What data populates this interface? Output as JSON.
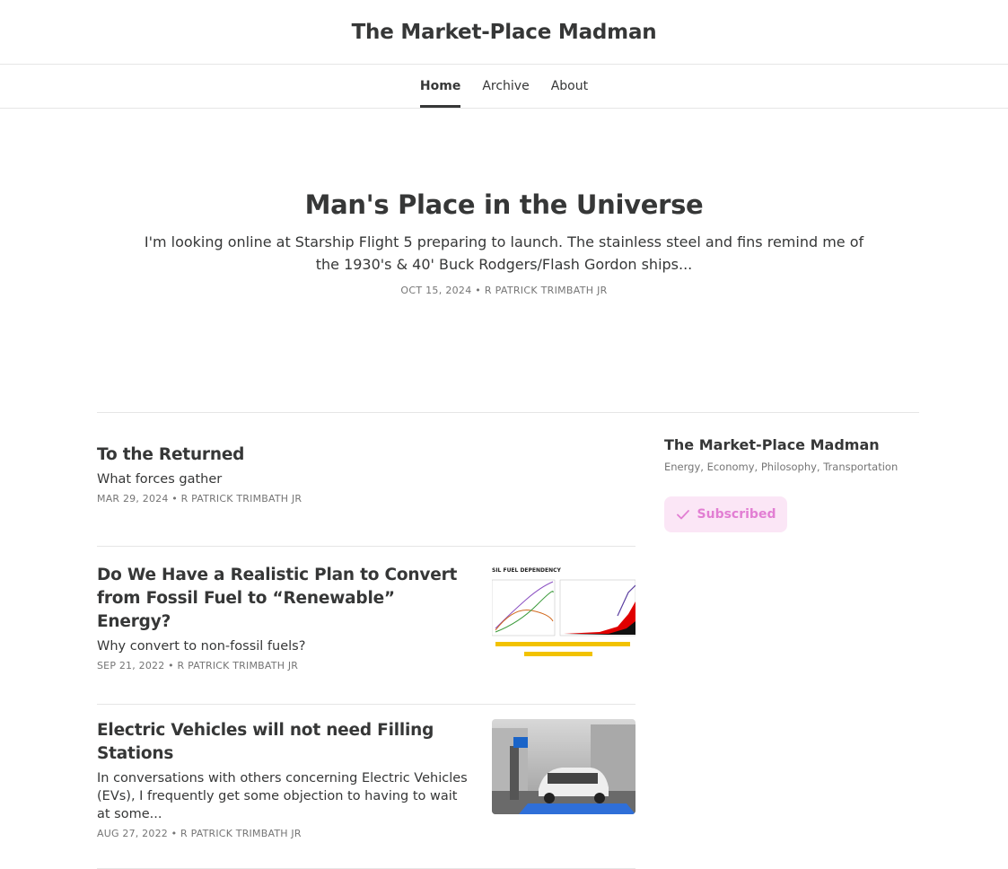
{
  "site": {
    "title": "The Market-Place Madman"
  },
  "nav": {
    "tabs": [
      {
        "label": "Home",
        "active": true
      },
      {
        "label": "Archive"
      },
      {
        "label": "About"
      }
    ]
  },
  "featured": {
    "title": "Man's Place in the Universe",
    "subtitle": "I'm looking online at Starship Flight 5 preparing to launch. The stainless steel and fins remind me of the 1930's & 40' Buck Rodgers/Flash Gordon ships...",
    "meta": "OCT 15, 2024 • R PATRICK TRIMBATH JR"
  },
  "posts": [
    {
      "title": "To the Returned",
      "subtitle": "What forces gather",
      "meta": "MAR 29, 2024 • R PATRICK TRIMBATH JR"
    },
    {
      "title": "Do We Have a Realistic Plan to Convert from Fossil Fuel to “Renewable” Energy?",
      "subtitle": "Why convert to non-fossil fuels?",
      "meta": "SEP 21, 2022 • R PATRICK TRIMBATH JR",
      "thumbnail": {
        "heading": "SIL FUEL DEPENDENCY"
      }
    },
    {
      "title": "Electric Vehicles will not need Filling Stations",
      "subtitle": "In conversations with others concerning Electric Vehicles (EVs), I frequently get some objection to having to wait at some...",
      "meta": "AUG 27, 2022 • R PATRICK TRIMBATH JR",
      "thumbnail": {
        "description": "electric car at charging station"
      }
    }
  ],
  "sidebar": {
    "title": "The Market-Place Madman",
    "tags": "Energy, Economy, Philosophy, Transportation",
    "subscribe_label": "Subscribed"
  },
  "colors": {
    "text": "#363737",
    "meta": "#757575",
    "subscribe_bg": "#fbe6f6",
    "subscribe_fg": "#e27ed3"
  }
}
